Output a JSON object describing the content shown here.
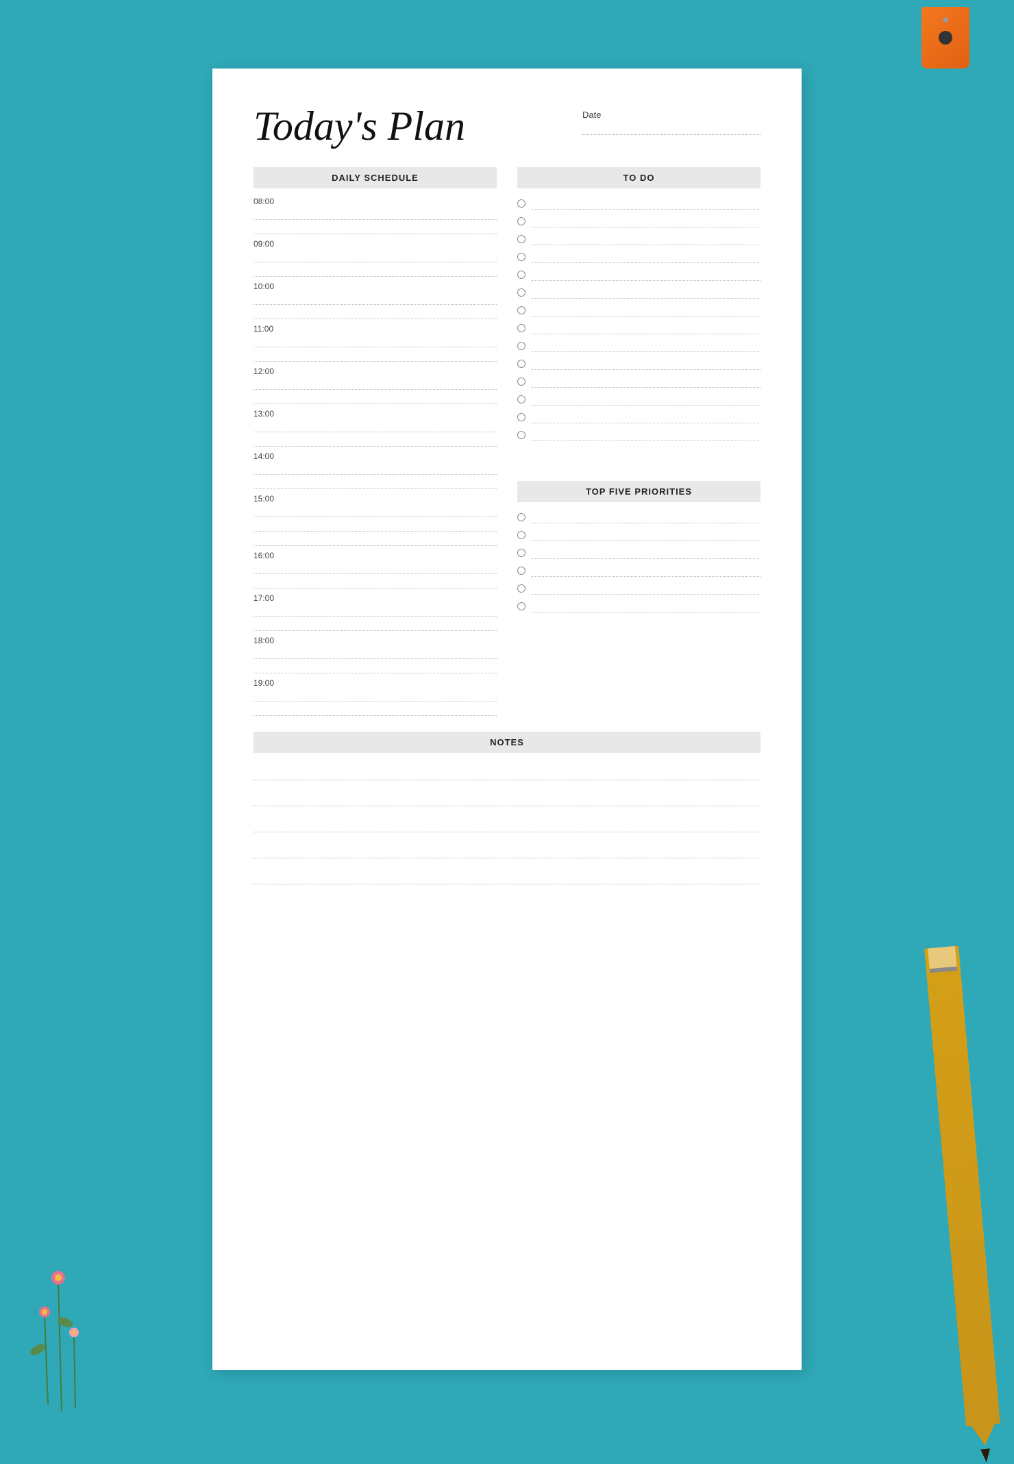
{
  "page": {
    "background_color": "#2fa8b8",
    "title": "Today's Plan",
    "date_label": "Date",
    "sections": {
      "daily_schedule": {
        "header": "DAILY SCHEDULE",
        "time_slots": [
          "08:00",
          "09:00",
          "10:00",
          "11:00",
          "12:00",
          "13:00",
          "14:00",
          "15:00",
          "16:00",
          "17:00",
          "18:00",
          "19:00"
        ]
      },
      "todo": {
        "header": "TO DO",
        "item_count": 14
      },
      "top_five_priorities": {
        "header": "TOP FIVE PRIORITIES",
        "item_count": 6
      },
      "notes": {
        "header": "NOTES",
        "line_count": 5
      }
    }
  }
}
